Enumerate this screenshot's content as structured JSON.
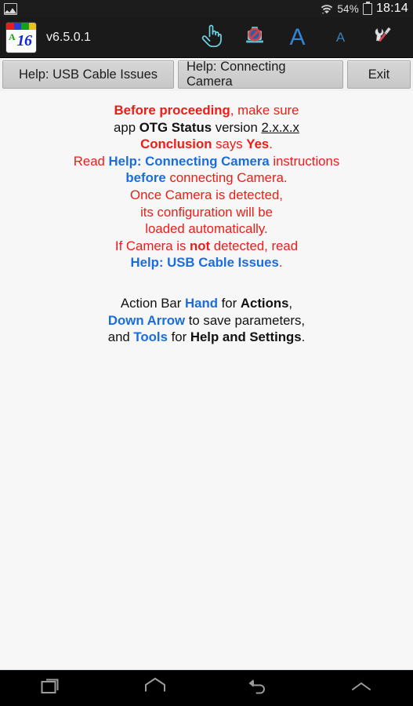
{
  "status_bar": {
    "notification_icon": "screenshot-icon",
    "wifi_icon": "wifi-icon",
    "battery_percent": "54%",
    "battery_icon": "battery-icon",
    "clock": "18:14"
  },
  "action_bar": {
    "app_icon": {
      "letter": "A",
      "number": "16",
      "stripe_colors": [
        "#e02020",
        "#2a3fd0",
        "#18a018",
        "#e8c41a"
      ]
    },
    "version": "v6.5.0.1",
    "icons": [
      {
        "name": "hand-icon",
        "label": "Hand"
      },
      {
        "name": "camera-disabled-icon",
        "label": "Camera Disabled"
      },
      {
        "name": "font-large-icon",
        "label": "A"
      },
      {
        "name": "font-small-icon",
        "label": "A"
      },
      {
        "name": "tools-icon",
        "label": "Tools"
      }
    ]
  },
  "buttons": {
    "help_usb": "Help: USB Cable Issues",
    "help_camera": "Help: Connecting Camera",
    "exit": "Exit"
  },
  "content": {
    "paragraph1": {
      "line1_a": "Before proceeding",
      "line1_b": ", make sure",
      "line2_a": "app ",
      "line2_b": "OTG Status",
      "line2_c": " version ",
      "line2_d": "2.x.x.x",
      "line3_a": "Conclusion",
      "line3_b": " says ",
      "line3_c": "Yes",
      "line3_d": ".",
      "line4_a": "Read ",
      "line4_b": "Help: Connecting Camera",
      "line4_c": " instructions",
      "line5_a": "before",
      "line5_b": " connecting Camera.",
      "line6": "Once Camera is detected,",
      "line7": "its configuration will be",
      "line8": "loaded automatically.",
      "line9_a": "If Camera is ",
      "line9_b": "not",
      "line9_c": " detected, read",
      "line10_a": "Help: USB Cable Issues",
      "line10_b": "."
    },
    "paragraph2": {
      "line1_a": "Action Bar ",
      "line1_b": "Hand",
      "line1_c": " for ",
      "line1_d": "Actions",
      "line1_e": ",",
      "line2_a": "Down Arrow",
      "line2_b": " to save parameters,",
      "line3_a": "and ",
      "line3_b": "Tools",
      "line3_c": " for ",
      "line3_d": "Help and Settings",
      "line3_e": "."
    }
  },
  "nav_bar": {
    "items": [
      {
        "name": "recents-icon",
        "label": "Recents"
      },
      {
        "name": "home-icon",
        "label": "Home"
      },
      {
        "name": "back-icon",
        "label": "Back"
      },
      {
        "name": "chevron-up-icon",
        "label": "Expand"
      }
    ]
  },
  "colors": {
    "red": "#ee1c17",
    "blue": "#1a6ddb",
    "black": "#111111",
    "background": "#f7f7f7",
    "action_bar": "#1a1a1a",
    "button_face": "#cfcfcf"
  }
}
